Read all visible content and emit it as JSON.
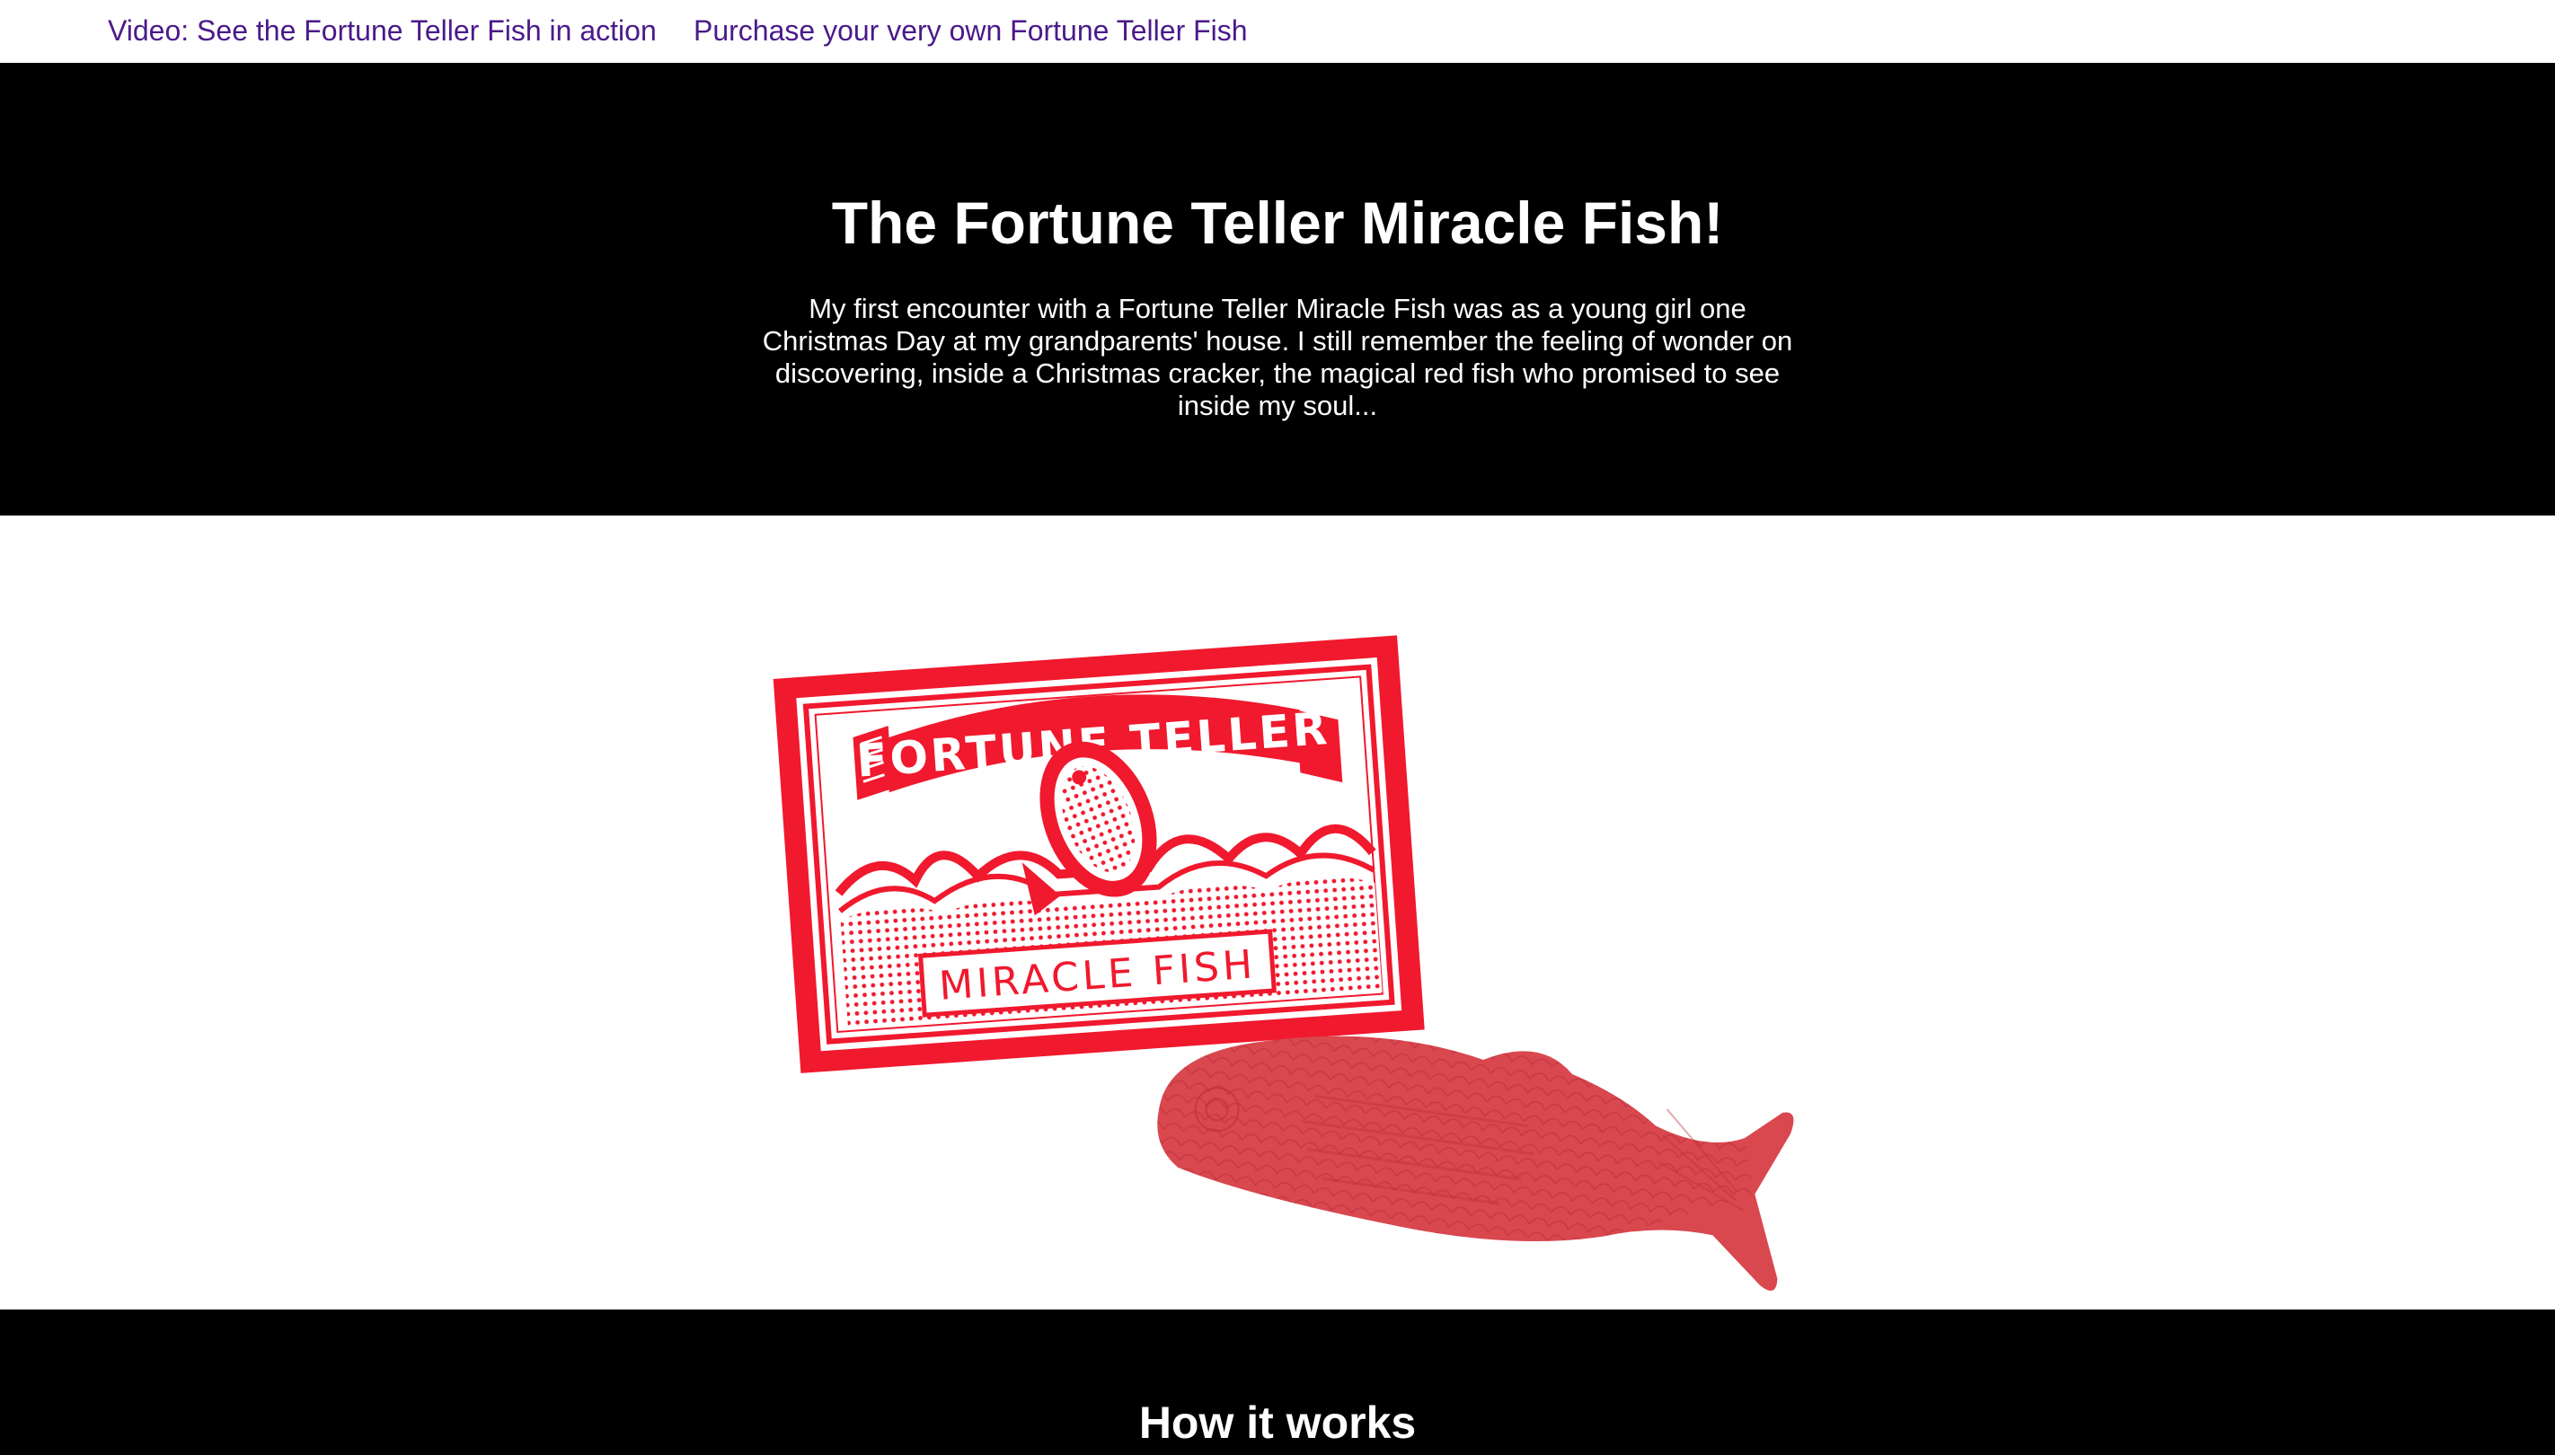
{
  "nav": {
    "video_link": "Video: See the Fortune Teller Fish in action",
    "purchase_link": "Purchase your very own Fortune Teller Fish"
  },
  "hero": {
    "title": "The Fortune Teller Miracle Fish!",
    "intro": "My first encounter with a Fortune Teller Miracle Fish was as a young girl one Christmas Day at my grandparents' house. I still remember the feeling of wonder on discovering, inside a Christmas cracker, the magical red fish who promised to see inside my soul..."
  },
  "product_image": {
    "packet_banner": "FORTUNE TELLER",
    "packet_label": "MIRACLE   FISH",
    "packet_color": "#f0192e",
    "fish_color": "#d9474f"
  },
  "how_it_works": {
    "heading": "How it works"
  }
}
